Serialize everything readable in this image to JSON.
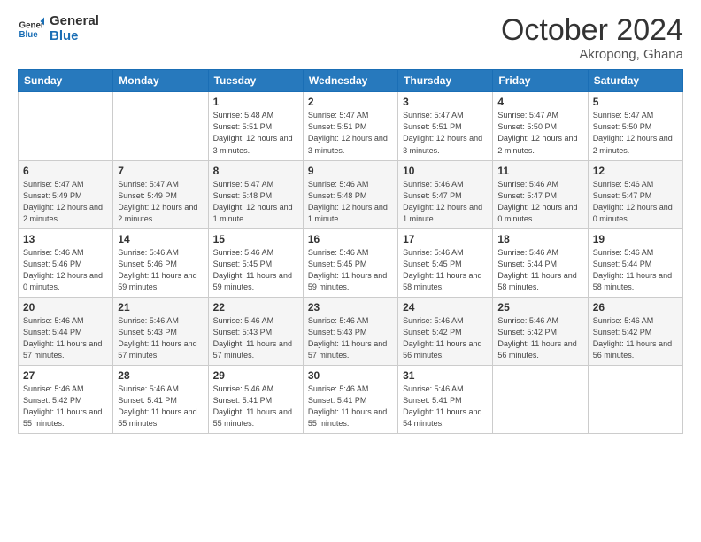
{
  "header": {
    "logo_line1": "General",
    "logo_line2": "Blue",
    "month": "October 2024",
    "location": "Akropong, Ghana"
  },
  "weekdays": [
    "Sunday",
    "Monday",
    "Tuesday",
    "Wednesday",
    "Thursday",
    "Friday",
    "Saturday"
  ],
  "weeks": [
    [
      {
        "day": "",
        "info": ""
      },
      {
        "day": "",
        "info": ""
      },
      {
        "day": "1",
        "info": "Sunrise: 5:48 AM\nSunset: 5:51 PM\nDaylight: 12 hours and 3 minutes."
      },
      {
        "day": "2",
        "info": "Sunrise: 5:47 AM\nSunset: 5:51 PM\nDaylight: 12 hours and 3 minutes."
      },
      {
        "day": "3",
        "info": "Sunrise: 5:47 AM\nSunset: 5:51 PM\nDaylight: 12 hours and 3 minutes."
      },
      {
        "day": "4",
        "info": "Sunrise: 5:47 AM\nSunset: 5:50 PM\nDaylight: 12 hours and 2 minutes."
      },
      {
        "day": "5",
        "info": "Sunrise: 5:47 AM\nSunset: 5:50 PM\nDaylight: 12 hours and 2 minutes."
      }
    ],
    [
      {
        "day": "6",
        "info": "Sunrise: 5:47 AM\nSunset: 5:49 PM\nDaylight: 12 hours and 2 minutes."
      },
      {
        "day": "7",
        "info": "Sunrise: 5:47 AM\nSunset: 5:49 PM\nDaylight: 12 hours and 2 minutes."
      },
      {
        "day": "8",
        "info": "Sunrise: 5:47 AM\nSunset: 5:48 PM\nDaylight: 12 hours and 1 minute."
      },
      {
        "day": "9",
        "info": "Sunrise: 5:46 AM\nSunset: 5:48 PM\nDaylight: 12 hours and 1 minute."
      },
      {
        "day": "10",
        "info": "Sunrise: 5:46 AM\nSunset: 5:47 PM\nDaylight: 12 hours and 1 minute."
      },
      {
        "day": "11",
        "info": "Sunrise: 5:46 AM\nSunset: 5:47 PM\nDaylight: 12 hours and 0 minutes."
      },
      {
        "day": "12",
        "info": "Sunrise: 5:46 AM\nSunset: 5:47 PM\nDaylight: 12 hours and 0 minutes."
      }
    ],
    [
      {
        "day": "13",
        "info": "Sunrise: 5:46 AM\nSunset: 5:46 PM\nDaylight: 12 hours and 0 minutes."
      },
      {
        "day": "14",
        "info": "Sunrise: 5:46 AM\nSunset: 5:46 PM\nDaylight: 11 hours and 59 minutes."
      },
      {
        "day": "15",
        "info": "Sunrise: 5:46 AM\nSunset: 5:45 PM\nDaylight: 11 hours and 59 minutes."
      },
      {
        "day": "16",
        "info": "Sunrise: 5:46 AM\nSunset: 5:45 PM\nDaylight: 11 hours and 59 minutes."
      },
      {
        "day": "17",
        "info": "Sunrise: 5:46 AM\nSunset: 5:45 PM\nDaylight: 11 hours and 58 minutes."
      },
      {
        "day": "18",
        "info": "Sunrise: 5:46 AM\nSunset: 5:44 PM\nDaylight: 11 hours and 58 minutes."
      },
      {
        "day": "19",
        "info": "Sunrise: 5:46 AM\nSunset: 5:44 PM\nDaylight: 11 hours and 58 minutes."
      }
    ],
    [
      {
        "day": "20",
        "info": "Sunrise: 5:46 AM\nSunset: 5:44 PM\nDaylight: 11 hours and 57 minutes."
      },
      {
        "day": "21",
        "info": "Sunrise: 5:46 AM\nSunset: 5:43 PM\nDaylight: 11 hours and 57 minutes."
      },
      {
        "day": "22",
        "info": "Sunrise: 5:46 AM\nSunset: 5:43 PM\nDaylight: 11 hours and 57 minutes."
      },
      {
        "day": "23",
        "info": "Sunrise: 5:46 AM\nSunset: 5:43 PM\nDaylight: 11 hours and 57 minutes."
      },
      {
        "day": "24",
        "info": "Sunrise: 5:46 AM\nSunset: 5:42 PM\nDaylight: 11 hours and 56 minutes."
      },
      {
        "day": "25",
        "info": "Sunrise: 5:46 AM\nSunset: 5:42 PM\nDaylight: 11 hours and 56 minutes."
      },
      {
        "day": "26",
        "info": "Sunrise: 5:46 AM\nSunset: 5:42 PM\nDaylight: 11 hours and 56 minutes."
      }
    ],
    [
      {
        "day": "27",
        "info": "Sunrise: 5:46 AM\nSunset: 5:42 PM\nDaylight: 11 hours and 55 minutes."
      },
      {
        "day": "28",
        "info": "Sunrise: 5:46 AM\nSunset: 5:41 PM\nDaylight: 11 hours and 55 minutes."
      },
      {
        "day": "29",
        "info": "Sunrise: 5:46 AM\nSunset: 5:41 PM\nDaylight: 11 hours and 55 minutes."
      },
      {
        "day": "30",
        "info": "Sunrise: 5:46 AM\nSunset: 5:41 PM\nDaylight: 11 hours and 55 minutes."
      },
      {
        "day": "31",
        "info": "Sunrise: 5:46 AM\nSunset: 5:41 PM\nDaylight: 11 hours and 54 minutes."
      },
      {
        "day": "",
        "info": ""
      },
      {
        "day": "",
        "info": ""
      }
    ]
  ]
}
